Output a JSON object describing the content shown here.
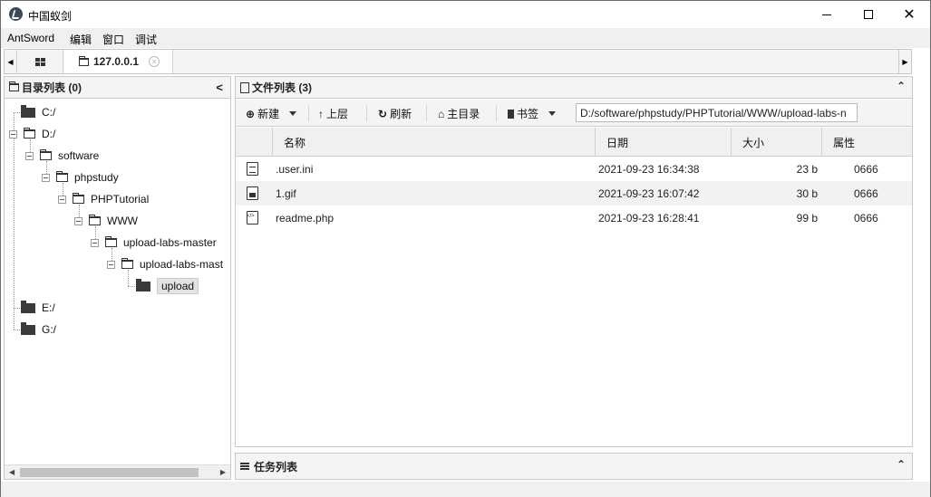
{
  "window": {
    "title": "中国蚁剑",
    "min_icon": "minimize-icon",
    "max_icon": "maximize-icon",
    "close_icon": "close-icon"
  },
  "menu": [
    "AntSword",
    "编辑",
    "窗口",
    "调试"
  ],
  "tabs": {
    "host_label": "127.0.0.1",
    "left_arrow": "◀",
    "right_arrow": "▶"
  },
  "left_panel": {
    "title": "目录列表 (0)",
    "collapse_glyph": "<"
  },
  "tree": {
    "c_drive": "C:/",
    "d_drive": "D:/",
    "software": "software",
    "phpstudy": "phpstudy",
    "phptutorial": "PHPTutorial",
    "www": "WWW",
    "upload_labs_master": "upload-labs-master",
    "upload_labs_mast": "upload-labs-mast",
    "upload": "upload",
    "e_drive": "E:/",
    "g_drive": "G:/"
  },
  "right_panel": {
    "title": "文件列表 (3)",
    "collapse_glyph": "⌃"
  },
  "toolbar": {
    "new_label": "新建",
    "up_label": "上层",
    "refresh_label": "刷新",
    "home_label": "主目录",
    "bookmark_label": "书签",
    "path_value": "D:/software/phpstudy/PHPTutorial/WWW/upload-labs-n"
  },
  "table": {
    "columns": [
      "名称",
      "日期",
      "大小",
      "属性"
    ],
    "rows": [
      {
        "icon": "text-file-icon",
        "name": ".user.ini",
        "date": "2021-09-23 16:34:38",
        "size": "23 b",
        "attr": "0666"
      },
      {
        "icon": "image-file-icon",
        "name": "1.gif",
        "date": "2021-09-23 16:07:42",
        "size": "30 b",
        "attr": "0666"
      },
      {
        "icon": "code-file-icon",
        "name": "readme.php",
        "date": "2021-09-23 16:28:41",
        "size": "99 b",
        "attr": "0666"
      }
    ]
  },
  "task_panel": {
    "title": "任务列表",
    "collapse_glyph": "⌃"
  }
}
